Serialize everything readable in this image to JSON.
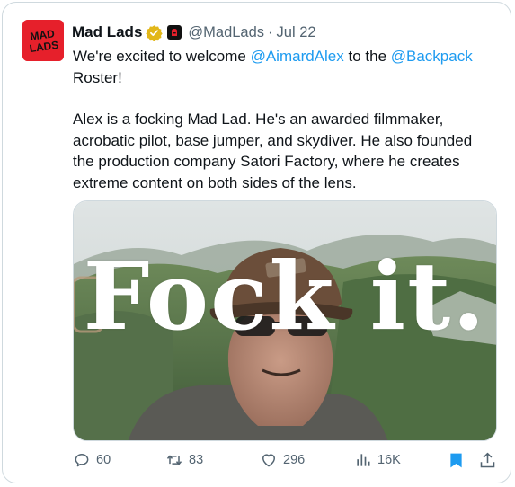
{
  "tweet": {
    "author_name": "Mad Lads",
    "handle": "@MadLads",
    "separator": "·",
    "date": "Jul 22",
    "avatar_text": "MAD LADS",
    "more_glyph": "···",
    "text_line1_prefix": "We're excited to welcome ",
    "mention1": "@AimardAlex",
    "text_line1_mid": " to the ",
    "mention2": "@Backpack",
    "text_line1_suffix": " Roster!",
    "paragraph2": "Alex is a focking Mad Lad. He's an awarded filmmaker, acrobatic pilot, base jumper, and skydiver. He also founded the production company Satori Factory, where he creates extreme content on both sides of the lens.",
    "media_overlay_text": "Fock it."
  },
  "actions": {
    "replies": "60",
    "reposts": "83",
    "likes": "296",
    "views": "16K"
  },
  "icons": {
    "verified": "gold-verified-badge-icon",
    "affiliate": "backpack-affiliate-icon",
    "reply": "reply-icon",
    "repost": "repost-icon",
    "like": "heart-icon",
    "views": "views-chart-icon",
    "bookmark": "bookmark-icon",
    "share": "share-icon"
  },
  "colors": {
    "link": "#1d9bf0",
    "secondary_text": "#536471",
    "bookmark_active": "#1d9bf0",
    "avatar_bg": "#e6202b",
    "verified_gold": "#e2b719"
  }
}
